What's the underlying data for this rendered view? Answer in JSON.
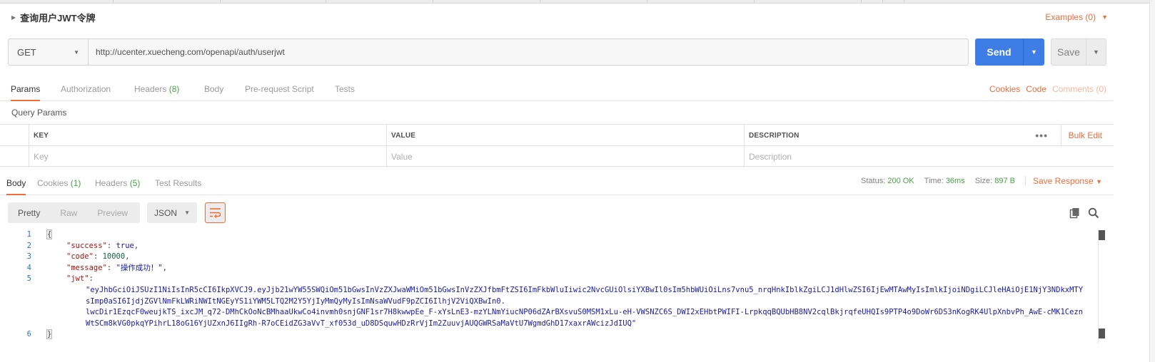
{
  "request": {
    "title": "查询用户JWT令牌",
    "examples_label": "Examples (0)",
    "method": "GET",
    "url": "http://ucenter.xuecheng.com/openapi/auth/userjwt",
    "send_label": "Send",
    "save_label": "Save"
  },
  "request_tabs": [
    {
      "label": "Params",
      "count": ""
    },
    {
      "label": "Authorization",
      "count": ""
    },
    {
      "label": "Headers",
      "count": "(8)"
    },
    {
      "label": "Body",
      "count": ""
    },
    {
      "label": "Pre-request Script",
      "count": ""
    },
    {
      "label": "Tests",
      "count": ""
    }
  ],
  "request_links": {
    "cookies": "Cookies",
    "code": "Code",
    "comments": "Comments (0)"
  },
  "query_params": {
    "title": "Query Params",
    "headers": {
      "key": "KEY",
      "value": "VALUE",
      "description": "DESCRIPTION"
    },
    "placeholders": {
      "key": "Key",
      "value": "Value",
      "description": "Description"
    },
    "bulk_edit": "Bulk Edit",
    "more": "•••"
  },
  "response_tabs": [
    {
      "label": "Body",
      "count": ""
    },
    {
      "label": "Cookies",
      "count": "(1)"
    },
    {
      "label": "Headers",
      "count": "(5)"
    },
    {
      "label": "Test Results",
      "count": ""
    }
  ],
  "response_meta": {
    "status_label": "Status:",
    "status_value": "200 OK",
    "time_label": "Time:",
    "time_value": "36ms",
    "size_label": "Size:",
    "size_value": "897 B",
    "save_response": "Save Response"
  },
  "view": {
    "modes": [
      "Pretty",
      "Raw",
      "Preview"
    ],
    "active_mode": "Pretty",
    "format": "JSON"
  },
  "code": {
    "line_numbers": [
      "1",
      "2",
      "3",
      "4",
      "5",
      "6"
    ],
    "open_brace": "{",
    "close_brace": "}",
    "success_key": "\"success\"",
    "success_value": "true",
    "code_key": "\"code\"",
    "code_value": "10000",
    "message_key": "\"message\"",
    "message_value": "\"操作成功！\"",
    "jwt_key": "\"jwt\"",
    "jwt_lines": [
      "\"eyJhbGciOiJSUzI1NiIsInR5cCI6IkpXVCJ9.eyJjb21wYW55SWQiOm51bGwsInVzZXJwaWMiOm51bGwsInVzZXJfbmFtZSI6ImFkbWluIiwic2NvcGUiOlsiYXBwIl0sIm5hbWUiOiLns7vnu5_nrqHnkIblkZgiLCJ1dHlwZSI6IjEwMTAwMyIsImlkIjoiNDgiLCJleHAiOjE1NjY3NDkxMTY",
      "sImp0aSI6IjdjZGVlNmFkLWRiNWItNGEyYS1iYWM5LTQ2M2Y5YjIyMmQyMyIsImNsaWVudF9pZCI6IlhjV2ViQXBwIn0.",
      "lwcDir1EzqcF0weujkTS_ixcJM_q72-DMhCkOoNcBMhaaUkwCo4invmh0snjGNF1sr7H8kwwpEe_F-xYsLnE3-mzYLNmYiucNP06dZArBXsvuS0MSM1xLu-eH-VWSNZC6S_DWI2xEHbtPWIFI-LrpkqqBQUbHB8NV2cqlBkjrqfeUHQIs9PTP4o9DoWr6DS3nKogRK4UlpXnbvPh_AwE-cMK1Cezn",
      "WtSCm8kVG0pkqYPihrL18oG16YjUZxnJ6IIgRh-R7oCEidZG3aVvT_xf053d_uD8DSquwHDzRrVjIm2ZuuvjAUQGWRSaMaVtU7WgmdGhD17xaxrAWcizJdIUQ\""
    ]
  },
  "colors": {
    "accent": "#f26b3a",
    "send": "#3d7de5",
    "success": "#47a447"
  }
}
